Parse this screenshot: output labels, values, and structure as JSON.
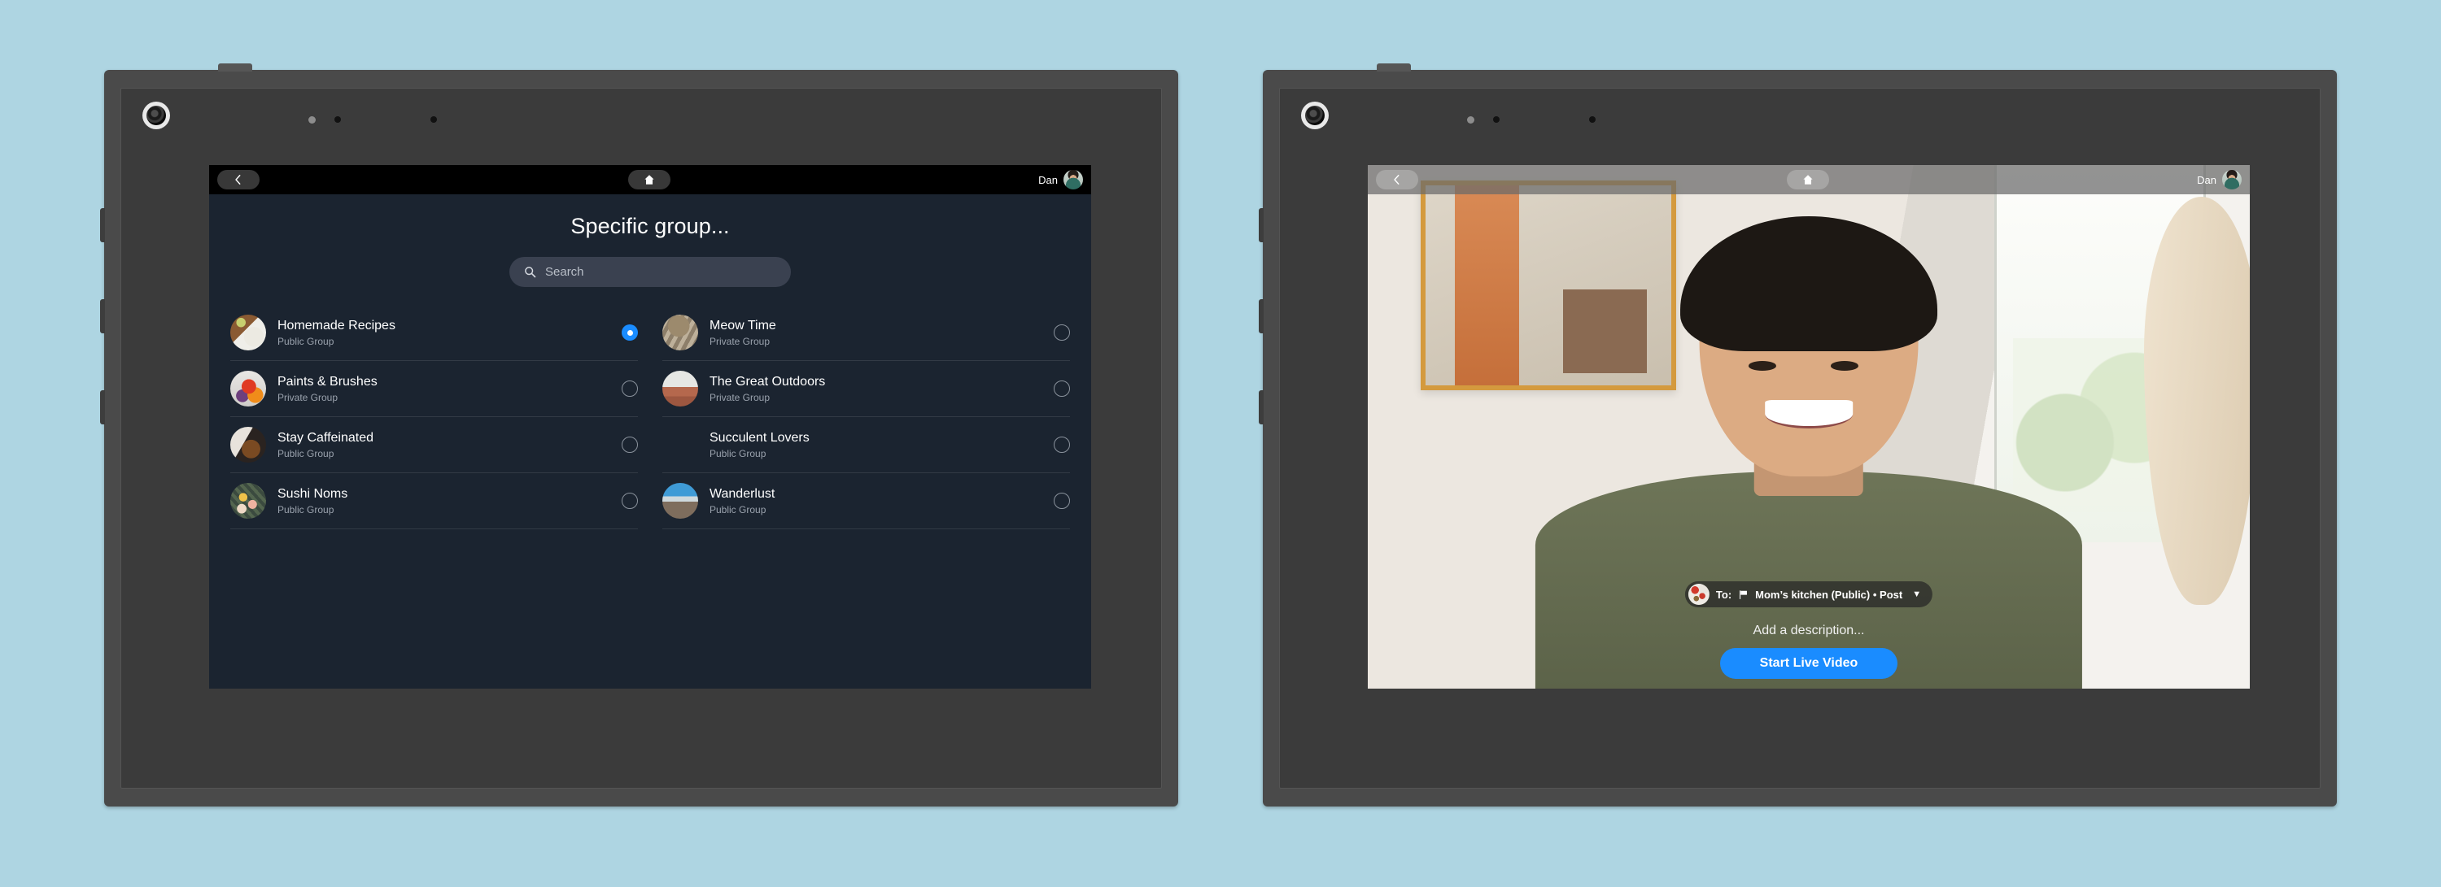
{
  "background_color": "#aed5e2",
  "accent_color": "#1a8cff",
  "devices": [
    {
      "id": "left",
      "screen_title": "Specific group...",
      "nav": {
        "back_icon": "chevron-left-icon",
        "home_icon": "home-icon",
        "user_name": "Dan",
        "avatar_icon": "user-avatar"
      },
      "search": {
        "placeholder": "Search",
        "value": "",
        "icon": "search-icon"
      },
      "groups": [
        {
          "name": "Homemade Recipes",
          "privacy": "Public Group",
          "selected": true,
          "thumb": "food-plate"
        },
        {
          "name": "Meow Time",
          "privacy": "Private Group",
          "selected": false,
          "thumb": "tabby-cat"
        },
        {
          "name": "Paints & Brushes",
          "privacy": "Private Group",
          "selected": false,
          "thumb": "paint-palette"
        },
        {
          "name": "The Great Outdoors",
          "privacy": "Private Group",
          "selected": false,
          "thumb": "desert-hiker"
        },
        {
          "name": "Stay Caffeinated",
          "privacy": "Public Group",
          "selected": false,
          "thumb": "latte-cup"
        },
        {
          "name": "Succulent Lovers",
          "privacy": "Public Group",
          "selected": false,
          "thumb": "succulents"
        },
        {
          "name": "Sushi Noms",
          "privacy": "Public Group",
          "selected": false,
          "thumb": "sushi-platter"
        },
        {
          "name": "Wanderlust",
          "privacy": "Public Group",
          "selected": false,
          "thumb": "mountain-vista"
        }
      ]
    },
    {
      "id": "right",
      "nav": {
        "back_icon": "chevron-left-icon",
        "home_icon": "home-icon",
        "user_name": "Dan",
        "avatar_icon": "user-avatar"
      },
      "composer": {
        "to_label": "To:",
        "audience_icon": "flag-icon",
        "audience": "Mom’s kitchen (Public) • Post",
        "caret_icon": "chevron-down-icon",
        "description_placeholder": "Add a description...",
        "cta_label": "Start Live Video"
      }
    }
  ]
}
